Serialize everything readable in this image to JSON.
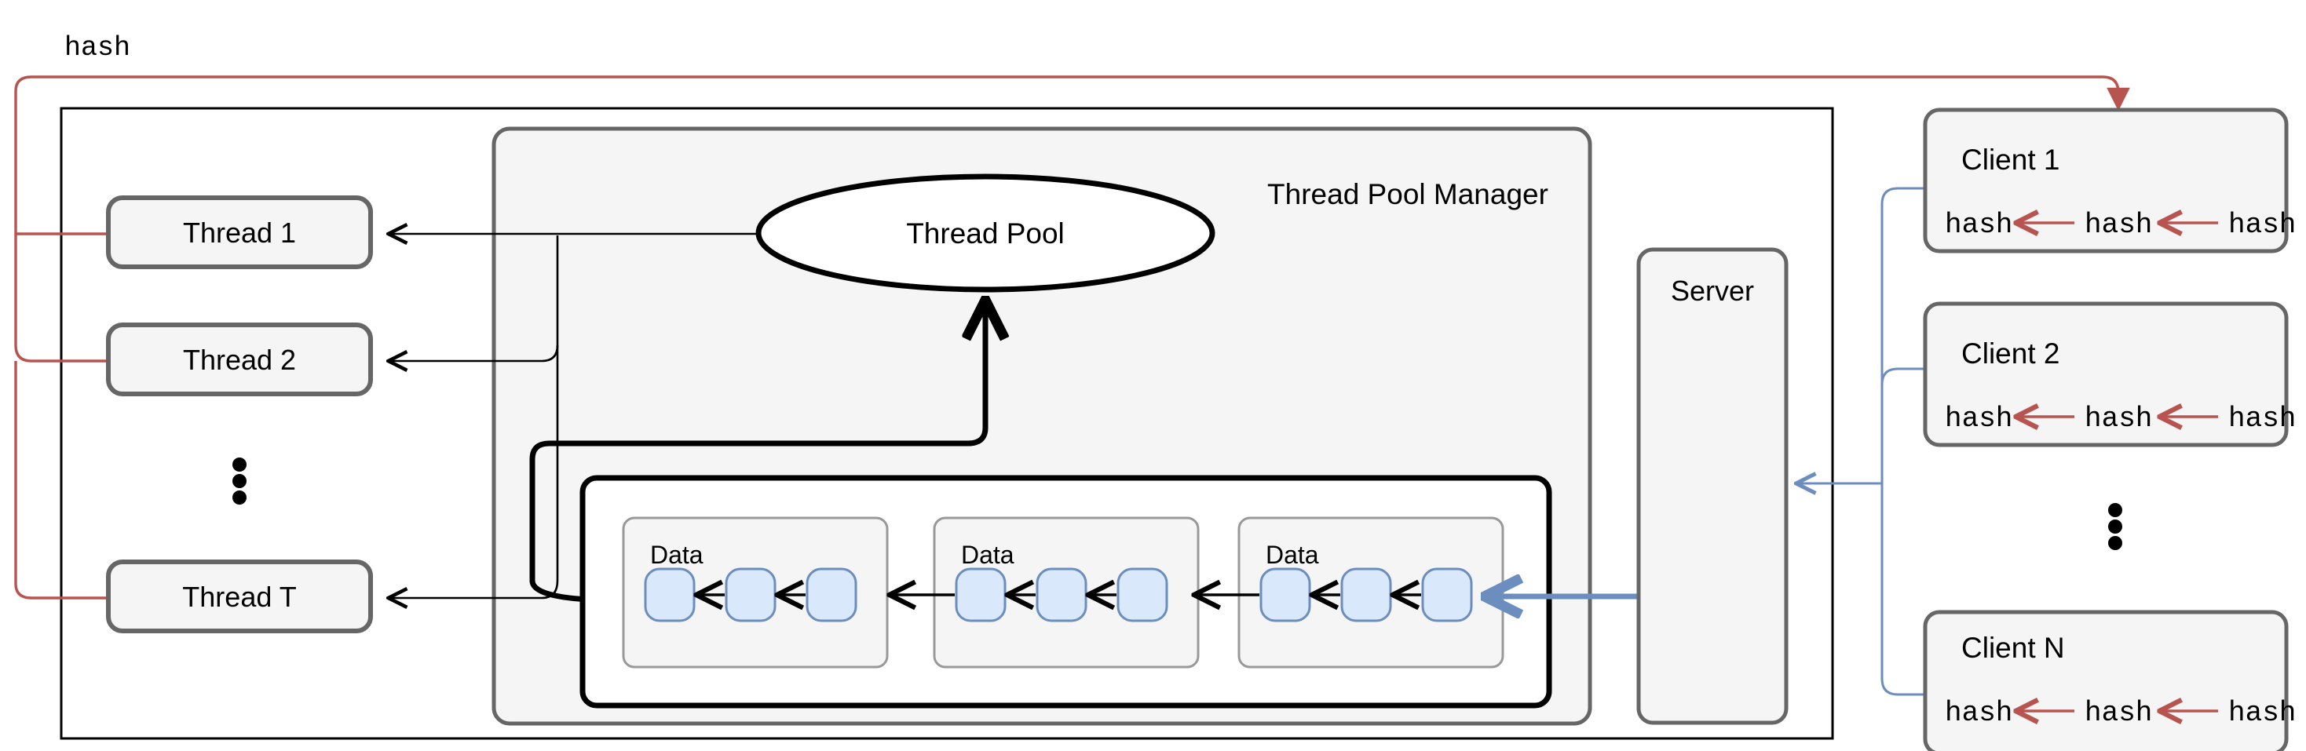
{
  "diagram": {
    "title_label": "hash",
    "thread_pool_manager": {
      "label": "Thread Pool Manager",
      "pool_node": "Thread Pool"
    },
    "threads": [
      {
        "label": "Thread 1"
      },
      {
        "label": "Thread 2"
      },
      {
        "label": "Thread T"
      }
    ],
    "threads_ellipsis": "⋮",
    "data_blocks": [
      {
        "label": "Data",
        "node_count": 3
      },
      {
        "label": "Data",
        "node_count": 3
      },
      {
        "label": "Data",
        "node_count": 3
      }
    ],
    "server": {
      "label": "Server"
    },
    "clients": [
      {
        "label": "Client 1",
        "hashes": [
          "hash",
          "hash",
          "hash"
        ]
      },
      {
        "label": "Client 2",
        "hashes": [
          "hash",
          "hash",
          "hash"
        ]
      },
      {
        "label": "Client N",
        "hashes": [
          "hash",
          "hash",
          "hash"
        ]
      }
    ],
    "clients_ellipsis": "⋮",
    "colors": {
      "red_edge": "#b85450",
      "blue_edge": "#6c8ebf",
      "node_fill": "#dae8fc",
      "node_stroke": "#6c8ebf",
      "box_fill": "#f5f5f5",
      "box_stroke": "#666666",
      "black_edge": "#000000",
      "manager_fill": "#f5f5f5"
    }
  }
}
